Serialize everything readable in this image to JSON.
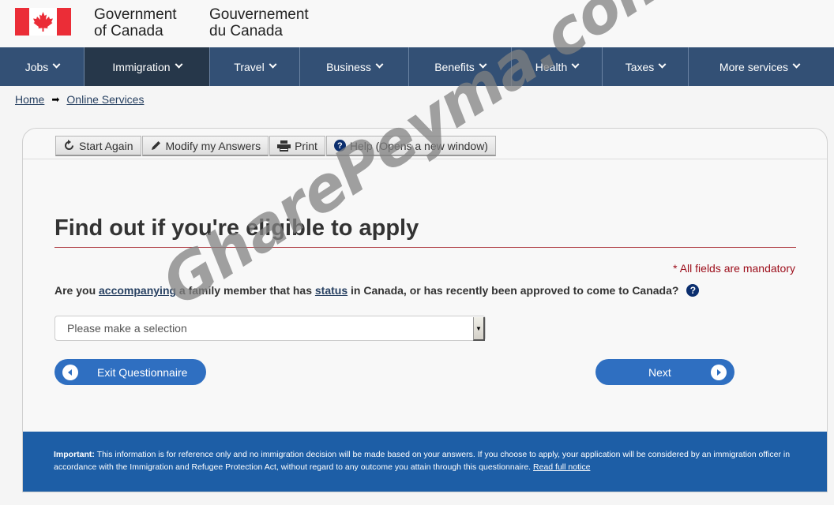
{
  "header": {
    "signature_en": [
      "Government",
      "of Canada"
    ],
    "signature_fr": [
      "Gouvernement",
      "du Canada"
    ],
    "colors": {
      "flag_red": "#eb2d37",
      "nav_bg": "#335075",
      "nav_active": "#26374a"
    }
  },
  "nav": {
    "items": [
      {
        "label": "Jobs",
        "active": false
      },
      {
        "label": "Immigration",
        "active": true
      },
      {
        "label": "Travel",
        "active": false
      },
      {
        "label": "Business",
        "active": false
      },
      {
        "label": "Benefits",
        "active": false
      },
      {
        "label": "Health",
        "active": false
      },
      {
        "label": "Taxes",
        "active": false
      },
      {
        "label": "More services",
        "active": false
      }
    ]
  },
  "breadcrumb": {
    "items": [
      "Home",
      "Online Services"
    ],
    "separator": "➡"
  },
  "toolbar": {
    "start_again": "Start Again",
    "modify_answers": "Modify my Answers",
    "print": "Print",
    "help": "Help (Opens a new window)"
  },
  "main": {
    "title": "Find out if you're eligible to apply",
    "mandatory_note": "* All fields are mandatory",
    "question": {
      "part1": "Are you ",
      "link1": "accompanying",
      "part2": " a family member that has ",
      "link2": "status",
      "part3": " in Canada, or has recently been approved to come to Canada?",
      "help_glyph": "?"
    },
    "select": {
      "value": "Please make a selection"
    },
    "exit_button": "Exit Questionnaire",
    "next_button": "Next"
  },
  "notice": {
    "label": "Important:",
    "text": " This information is for reference only and no immigration decision will be made based on your answers. If you choose to apply, your application will be considered by an immigration officer in accordance with the Immigration and Refugee Protection Act, without regard to any outcome you attain through this questionnaire. ",
    "link": "Read full notice"
  },
  "watermark": {
    "text": "GharePeyma.com _ قاره پیما"
  }
}
